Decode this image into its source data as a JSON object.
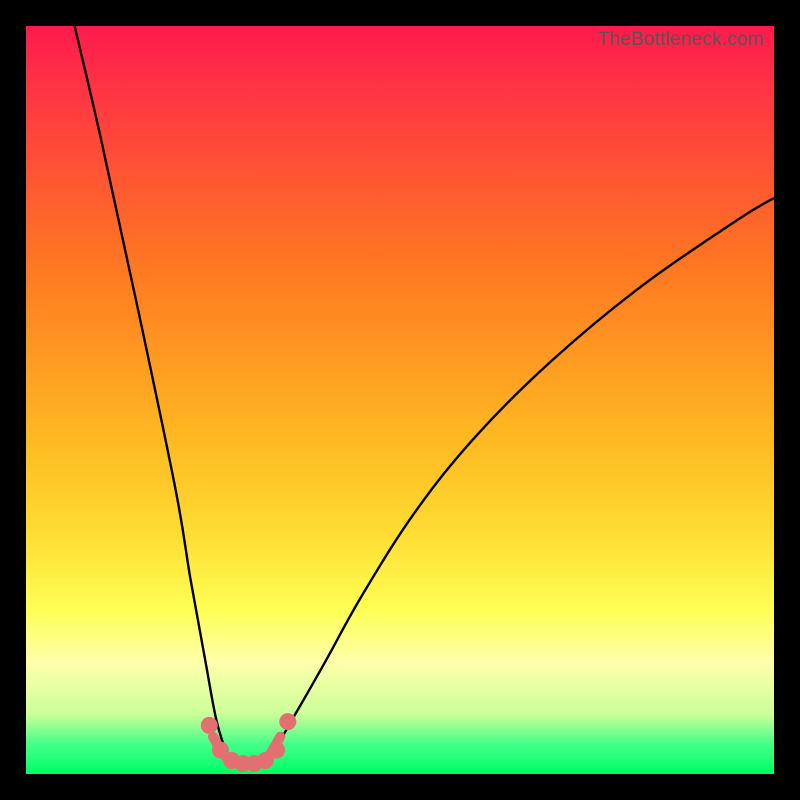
{
  "watermark": {
    "text": "TheBottleneck.com"
  },
  "chart_data": {
    "type": "line",
    "title": "",
    "xlabel": "",
    "ylabel": "",
    "xlim": [
      0,
      100
    ],
    "ylim": [
      0,
      100
    ],
    "background_gradient": {
      "top_color": "#ff1a4d",
      "bottom_color": "#00ff66",
      "meaning": "top=bad (high bottleneck), bottom=good (low bottleneck)"
    },
    "series": [
      {
        "name": "left-curve",
        "type": "line",
        "x": [
          6.5,
          10,
          15,
          20,
          22,
          24,
          25.5,
          27,
          28
        ],
        "y": [
          100,
          85,
          62,
          38,
          26,
          15,
          7,
          2.5,
          1.5
        ]
      },
      {
        "name": "right-curve",
        "type": "line",
        "x": [
          31,
          33,
          36,
          40,
          45,
          52,
          60,
          70,
          82,
          95,
          100
        ],
        "y": [
          1.5,
          3,
          8,
          15,
          24,
          35,
          45,
          55,
          65,
          74,
          77
        ]
      },
      {
        "name": "bottom-connector",
        "type": "line",
        "x": [
          25,
          26.5,
          28,
          29.5,
          31,
          32.5,
          34
        ],
        "y": [
          5,
          2.5,
          1.5,
          1.3,
          1.5,
          2.5,
          5
        ]
      }
    ],
    "markers": {
      "name": "highlighted-points",
      "color": "#e37070",
      "points": [
        {
          "x": 24.5,
          "y": 6.5
        },
        {
          "x": 26.0,
          "y": 3.2
        },
        {
          "x": 27.5,
          "y": 1.8
        },
        {
          "x": 29.0,
          "y": 1.4
        },
        {
          "x": 30.5,
          "y": 1.4
        },
        {
          "x": 32.0,
          "y": 1.8
        },
        {
          "x": 33.5,
          "y": 3.2
        },
        {
          "x": 35.0,
          "y": 7.0
        }
      ]
    }
  }
}
